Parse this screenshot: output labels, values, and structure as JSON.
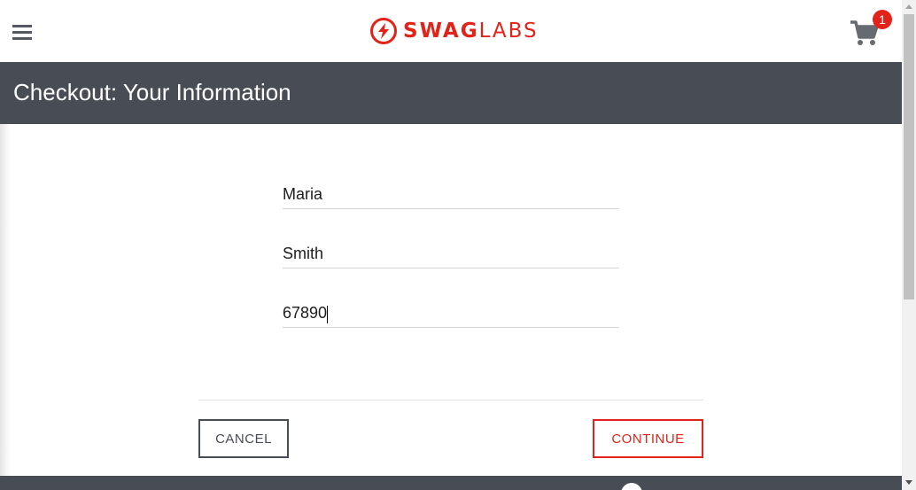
{
  "header": {
    "logo_bold": "SWAG",
    "logo_light": "LABS",
    "menu_icon": "hamburger-menu-icon",
    "cart_icon": "shopping-cart-icon",
    "cart_count": "1"
  },
  "title_bar": {
    "title": "Checkout: Your Information"
  },
  "form": {
    "first_name_value": "Maria",
    "last_name_value": "Smith",
    "postal_code_value": "67890"
  },
  "actions": {
    "cancel_label": "CANCEL",
    "continue_label": "CONTINUE"
  },
  "colors": {
    "brand_red": "#e2231a",
    "header_dark": "#484c55",
    "text": "#1d1d1d"
  }
}
